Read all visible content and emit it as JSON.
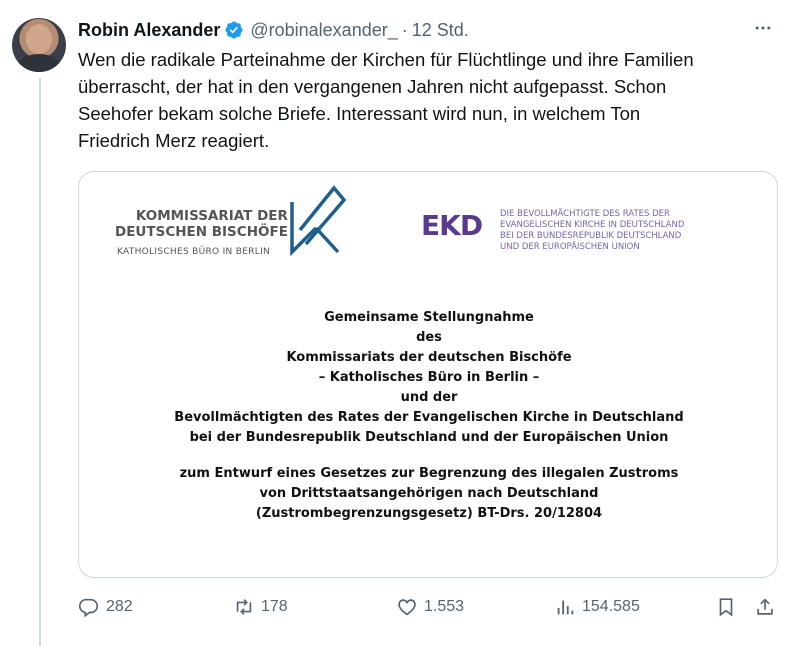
{
  "author": {
    "name": "Robin Alexander",
    "handle": "@robinalexander_",
    "separator": "·",
    "time": "12 Std."
  },
  "tweet": {
    "lines": [
      "Wen die radikale Parteinahme der Kirchen für Flüchtlinge und ihre Familien",
      "überrascht, der hat in den vergangenen Jahren nicht aufgepasst. Schon",
      "Seehofer bekam solche Briefe. Interessant wird nun, in welchem Ton",
      "Friedrich Merz reagiert."
    ]
  },
  "media": {
    "kb_title_line1": "KOMMISSARIAT DER",
    "kb_title_line2": "DEUTSCHEN BISCHÖFE",
    "kb_subtitle": "KATHOLISCHES BÜRO IN BERLIN",
    "ekd_logo": "EKD",
    "ekd_lines": [
      "DIE BEVOLLMÄCHTIGTE DES RATES DER",
      "EVANGELISCHEN KIRCHE IN DEUTSCHLAND",
      "BEI DER BUNDESREPUBLIK DEUTSCHLAND",
      "UND DER EUROPÄISCHEN UNION"
    ],
    "doc_lines_a": [
      "Gemeinsame Stellungnahme",
      "des",
      "Kommissariats der deutschen Bischöfe",
      "– Katholisches Büro in Berlin –",
      "und der",
      "Bevollmächtigten des Rates der Evangelischen Kirche in Deutschland",
      "bei der Bundesrepublik Deutschland und der Europäischen Union"
    ],
    "doc_lines_b": [
      "zum Entwurf eines Gesetzes zur Begrenzung des illegalen Zustroms",
      "von Drittstaatsangehörigen nach Deutschland",
      "(Zustrombegrenzungsgesetz) BT-Drs. 20/12804"
    ]
  },
  "actions": {
    "replies": "282",
    "reposts": "178",
    "likes": "1.553",
    "views": "154.585"
  },
  "icons": {
    "verified": "verified-badge-icon",
    "more": "more-icon",
    "reply": "reply-icon",
    "repost": "repost-icon",
    "like": "heart-icon",
    "views": "views-icon",
    "bookmark": "bookmark-icon",
    "share": "share-icon"
  },
  "colors": {
    "accent": "#1d9bf0",
    "secondary_text": "#536471",
    "ekd_purple": "#5a3a8e",
    "kb_blue": "#1f5f8b"
  }
}
